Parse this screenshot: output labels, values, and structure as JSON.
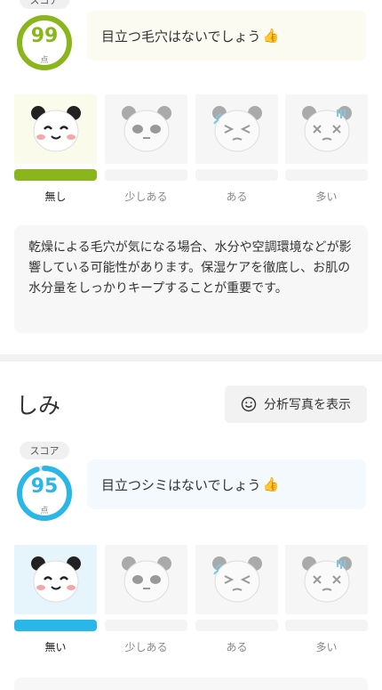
{
  "pores": {
    "score_label": "スコア",
    "score": "99",
    "score_fraction": 0.99,
    "unit": "点",
    "message": "目立つ毛穴はないでしょう",
    "accent": "#8ab61c",
    "levels": [
      "無し",
      "少しある",
      "ある",
      "多い"
    ],
    "selected_level": 0,
    "description": "乾燥による毛穴が気になる場合、水分や空調環境などが影響している可能性があります。保湿ケアを徹底し、お肌の水分量をしっかりキープすることが重要です。"
  },
  "spots": {
    "title": "しみ",
    "photo_button": "分析写真を表示",
    "score_label": "スコア",
    "score": "95",
    "score_fraction": 0.95,
    "unit": "点",
    "message": "目立つシミはないでしょう",
    "accent": "#29b6e8",
    "levels": [
      "無い",
      "少しある",
      "ある",
      "多い"
    ],
    "selected_level": 0
  },
  "icons": {
    "thumb": "thumbs-up-icon",
    "smile": "smile-icon",
    "faces": [
      "panda-happy-icon",
      "panda-neutral-icon",
      "panda-sweat-icon",
      "panda-distressed-icon"
    ]
  }
}
